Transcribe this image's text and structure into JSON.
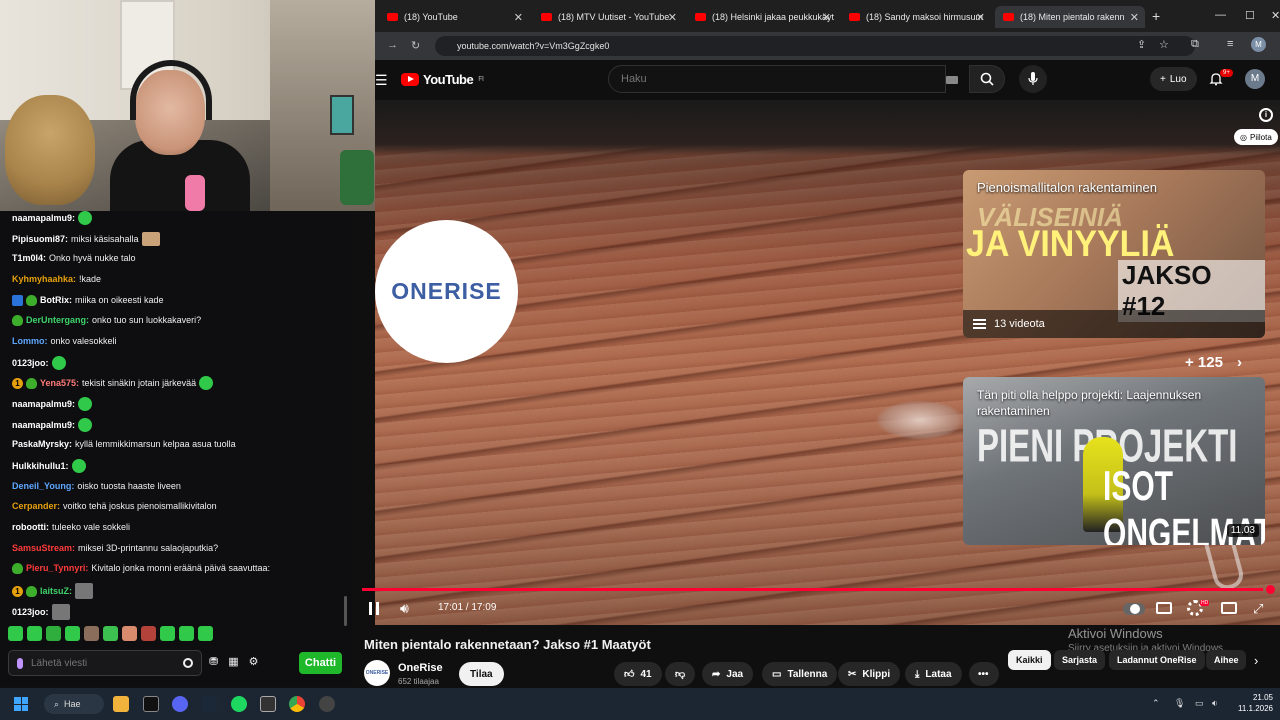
{
  "browser": {
    "tabs": [
      {
        "label": "(18) YouTube"
      },
      {
        "label": "(18) MTV Uutiset - YouTube"
      },
      {
        "label": "(18) Helsinki jakaa peukkukäyt"
      },
      {
        "label": "(18) Sandy maksoi hirmusum"
      },
      {
        "label": "(18) Miten pientalo rakenn"
      }
    ],
    "url": "youtube.com/watch?v=Vm3GgZcgke0",
    "profile_initial": "M"
  },
  "youtube": {
    "logo_text": "YouTube",
    "region": "FI",
    "search_placeholder": "Haku",
    "create_label": "Luo",
    "notification_count": "9+",
    "user_initial": "M",
    "video": {
      "logo_text": "ONERISE",
      "hide_label": "Piilota",
      "card1": {
        "title": "Pienoismallitalon rakentaminen",
        "thumb_line1": "VÄLISEINIÄ",
        "thumb_line2": "JA VINYYLIÄ",
        "thumb_line3": "JAKSO #12",
        "playlist_count": "13 videota"
      },
      "more_count": "+ 125",
      "card2": {
        "title": "Tän piti olla helppo projekti: Laajennuksen rakentaminen",
        "thumb_line1": "PIENI PROJEKTI",
        "thumb_line2": "ISOT ONGELMAT",
        "duration": "11.03"
      },
      "time": "17:01 / 17:09",
      "progress": 0.992
    },
    "title": "Miten pientalo rakennetaan? Jakso #1 Maatyöt",
    "channel": {
      "name": "OneRise",
      "subs": "652 tilaajaa",
      "avatar_text": "ONERISE"
    },
    "subscribe_label": "Tilaa",
    "actions": {
      "likes": "41",
      "share": "Jaa",
      "save": "Tallenna",
      "clip": "Klippi",
      "download": "Lataa"
    },
    "chips": [
      "Kaikki",
      "Sarjasta",
      "Ladannut OneRise",
      "Aihee"
    ],
    "activate_windows": {
      "title": "Aktivoi Windows",
      "subtitle": "Siirry asetuksiin ja aktivoi Windows."
    }
  },
  "chat": {
    "messages": [
      {
        "user": "naamapalmu9:",
        "color": "#ffffff",
        "text": ""
      },
      {
        "user": "Pipisuomi87:",
        "color": "#ffffff",
        "text": "miksi käsisahalla"
      },
      {
        "user": "T1m0l4:",
        "color": "#ffffff",
        "text": "Onko hyvä nukke talo"
      },
      {
        "user": "Kyhmyhaahka:",
        "color": "#e5a00d",
        "text": "!kade"
      },
      {
        "user": "BotRix:",
        "color": "#ffffff",
        "text": "miika on oikeesti kade"
      },
      {
        "user": "DerUntergang:",
        "color": "#3dd36a",
        "text": "onko tuo sun luokkakaveri?"
      },
      {
        "user": "Lommo:",
        "color": "#5ea7ff",
        "text": "onko valesokkeli"
      },
      {
        "user": "0123joo:",
        "color": "#ffffff",
        "text": ""
      },
      {
        "user": "Yena575:",
        "color": "#ff7a7a",
        "text": "tekisit sinäkin jotain järkevää"
      },
      {
        "user": "naamapalmu9:",
        "color": "#ffffff",
        "text": ""
      },
      {
        "user": "naamapalmu9:",
        "color": "#ffffff",
        "text": ""
      },
      {
        "user": "PaskaMyrsky:",
        "color": "#ffffff",
        "text": "kyllä lemmikkimarsun kelpaa asua tuolla"
      },
      {
        "user": "Hulkkihullu1:",
        "color": "#ffffff",
        "text": ""
      },
      {
        "user": "Deneil_Young:",
        "color": "#5ea7ff",
        "text": "oisko tuosta haaste liveen"
      },
      {
        "user": "Cerpander:",
        "color": "#e5a00d",
        "text": "voitko tehä joskus pienoismallikivitalon"
      },
      {
        "user": "robootti:",
        "color": "#ffffff",
        "text": "tuleeko vale sokkeli"
      },
      {
        "user": "SamsuStream:",
        "color": "#ff3b3b",
        "text": "miksei 3D-printannu salaojaputkia?"
      },
      {
        "user": "Pieru_Tynnyri:",
        "color": "#ff3b3b",
        "text": "Kivitalo jonka monni eräänä päivä saavuttaa:"
      },
      {
        "user": "laitsuZ:",
        "color": "#3dd36a",
        "text": ""
      },
      {
        "user": "0123joo:",
        "color": "#ffffff",
        "text": ""
      }
    ],
    "input_placeholder": "Lähetä viesti",
    "send_label": "Chatti",
    "badge_gold": "1"
  },
  "taskbar": {
    "search_label": "Hae",
    "time": "21.05",
    "date": "11.1.2026"
  }
}
